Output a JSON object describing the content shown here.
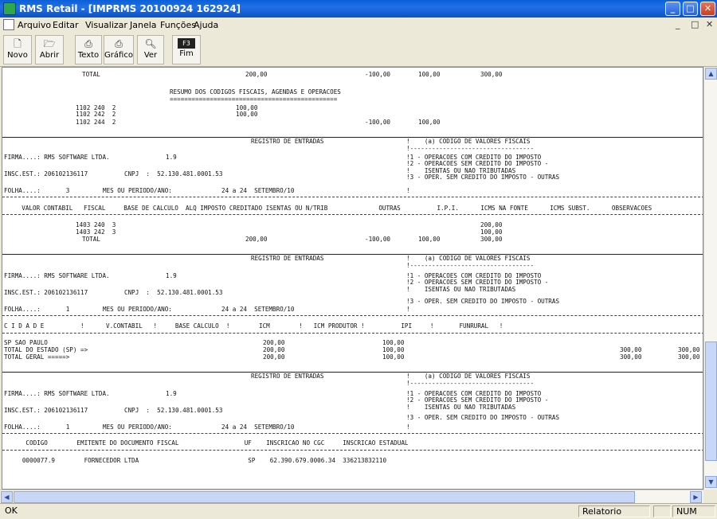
{
  "window": {
    "title": "RMS Retail - [IMPRMS 20100924 162924]"
  },
  "window_controls": {
    "minimize": "_",
    "maximize": "□",
    "close": "✕"
  },
  "menu": {
    "items": [
      "Arquivo",
      "Editar",
      "Visualizar",
      "Janela",
      "Funções",
      "Ajuda"
    ],
    "mdi_min": "_",
    "mdi_max": "□",
    "mdi_close": "✕"
  },
  "toolbar": {
    "buttons": [
      {
        "label": "Novo",
        "icon": "new-document-icon"
      },
      {
        "label": "Abrir",
        "icon": "open-folder-icon"
      },
      {
        "label": "Texto",
        "icon": "printer-icon"
      },
      {
        "label": "Gráfico",
        "icon": "printer-graphic-icon"
      },
      {
        "label": "Ver",
        "icon": "print-preview-icon"
      },
      {
        "label": "Fim",
        "icon": "f3-key-icon",
        "key": "F3"
      }
    ]
  },
  "report": {
    "top_total": {
      "label": "TOTAL",
      "v1": "200,00",
      "v2": "-100,00",
      "v3": "100,00",
      "v4": "300,00"
    },
    "resumo": {
      "title": "RESUMO DOS CODIGOS FISCAIS, AGENDAS E OPERACOES",
      "underline": "==============================================",
      "rows": [
        {
          "code": "1102 240  2",
          "v1": "100,00",
          "v2": "",
          "v3": ""
        },
        {
          "code": "1102 242  2",
          "v1": "100,00",
          "v2": "",
          "v3": ""
        },
        {
          "code": "1102 244  2",
          "v1": "",
          "v2": "-100,00",
          "v3": "100,00"
        }
      ]
    },
    "header": {
      "title": "REGISTRO DE ENTRADAS",
      "codigo_title": "!    (a) CODIGO DE VALORES FISCAIS",
      "codigo_sep": "!----------------------------------",
      "firma": "FIRMA....: RMS SOFTWARE LTDA.",
      "firma_ver": "1.9",
      "cod1": "!1 - OPERACOES COM CREDITO DO IMPOSTO",
      "cod2": "!2 - OPERACOES SEM CREDITO DO IMPOSTO -",
      "inscest": "INSC.EST.: 206102136117",
      "cnpj": "CNPJ  :  52.130.481.0001.53",
      "cod2b": "!    ISENTAS OU NAO TRIBUTADAS",
      "cod3": "!3 - OPER. SEM CREDITO DO IMPOSTO - OUTRAS",
      "mes": "MES OU PERIODO/ANO:",
      "periodo": "24 a 24  SETEMBRO/10",
      "bang": "!"
    },
    "folhas": [
      "FOLHA....:       3",
      "FOLHA....:       1",
      "FOLHA....:       1"
    ],
    "section1": {
      "columns": "    VALOR CONTABIL   FISCAL     BASE DE CALCULO  ALQ IMPOSTO CREDITADO ISENTAS OU N/TRIB              OUTRAS          I.P.I.      ICMS NA FONTE      ICMS SUBST.      OBSERVACOES",
      "rows": [
        {
          "code": "1403 240  3",
          "v": "200,00"
        },
        {
          "code": "1403 242  3",
          "v": "100,00"
        }
      ],
      "total": {
        "label": "TOTAL",
        "v1": "200,00",
        "v2": "-100,00",
        "v3": "100,00",
        "v4": "300,00"
      }
    },
    "section2": {
      "columns": "C I D A D E          !      V.CONTABIL   !     BASE CALCULO  !        ICM        !   ICM PRODUTOR !          IPI     !       FUNRURAL   !",
      "rows": [
        {
          "label": "SP SAO PAULO",
          "v1": "200,00",
          "v2": "100,00",
          "v3": "",
          "v4": ""
        },
        {
          "label": "TOTAL DO ESTADO (SP) =>",
          "v1": "200,00",
          "v2": "100,00",
          "v3": "300,00",
          "v4": "300,00"
        },
        {
          "label": "TOTAL GERAL =====>",
          "v1": "200,00",
          "v2": "100,00",
          "v3": "300,00",
          "v4": "300,00"
        }
      ]
    },
    "section3": {
      "columns": "      CODIGO        EMITENTE DO DOCUMENTO FISCAL                  UF    INSCRICAO NO CGC     INSCRICAO ESTADUAL",
      "row": "     0000077.9        FORNECEDOR LTDA                              SP    62.390.679.0006.34  336213832110"
    }
  },
  "scrollbars": {
    "up": "▲",
    "down": "▼",
    "left": "◀",
    "right": "▶"
  },
  "status": {
    "left": "OK",
    "center": "Relatorio",
    "right": "NUM"
  }
}
